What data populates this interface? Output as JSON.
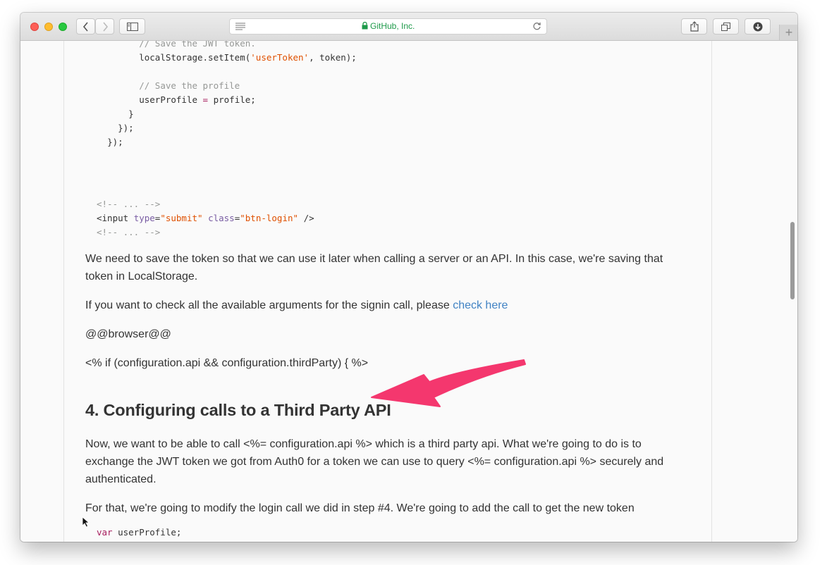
{
  "browser": {
    "site_label": "GitHub, Inc.",
    "icons": [
      "back-icon",
      "forward-icon",
      "sidebar-icon",
      "reader-icon",
      "lock-icon",
      "reload-icon",
      "share-icon",
      "tabs-icon",
      "downloads-icon",
      "new-tab-icon"
    ],
    "new_tab_label": "+"
  },
  "code_top": {
    "l1": "// Save the JWT token.",
    "l2a": "localStorage.setItem(",
    "l2b": "'userToken'",
    "l2c": ", token);",
    "l3": "// Save the profile",
    "l4a": "userProfile ",
    "l4b": "=",
    "l4c": " profile;",
    "l5": "}",
    "l6": "});",
    "l7": "});"
  },
  "code_html": {
    "c1": "<!-- ... -->",
    "t1": "<input",
    "a1": "type",
    "v1": "\"submit\"",
    "a2": "class",
    "v2": "\"btn-login\"",
    "t2": "/>",
    "c2": "<!-- ... -->"
  },
  "content": {
    "p1": "We need to save the token so that we can use it later when calling a server or an API. In this case, we're saving that token in LocalStorage.",
    "p2_text": "If you want to check all the available arguments for the signin call, please ",
    "p2_link": "check here",
    "p3": "@@browser@@",
    "p4": "<% if (configuration.api && configuration.thirdParty) { %>",
    "heading": "4. Configuring calls to a Third Party API",
    "p5": "Now, we want to be able to call <%= configuration.api %> which is a third party api. What we're going to do is to exchange the JWT token we got from Auth0 for a token we can use to query <%= configuration.api %> securely and authenticated.",
    "p6": "For that, we're going to modify the login call we did in step #4. We're going to add the call to get the new token"
  },
  "code_bottom": {
    "kw": "var",
    "rest": " userProfile;"
  },
  "colors": {
    "arrow": "#f4376e",
    "link": "#4183c4",
    "site_label": "#1e9a4a"
  }
}
